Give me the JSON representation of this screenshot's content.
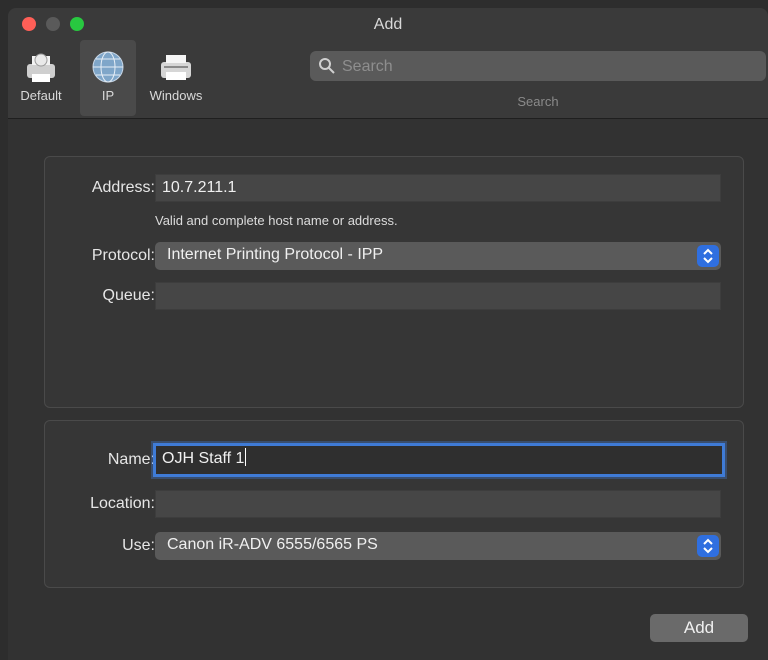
{
  "window": {
    "title": "Add"
  },
  "toolbar": {
    "items": [
      {
        "label": "Default",
        "icon": "default-printer-icon"
      },
      {
        "label": "IP",
        "icon": "globe-icon"
      },
      {
        "label": "Windows",
        "icon": "windows-printer-icon"
      }
    ],
    "search": {
      "placeholder": "Search",
      "label": "Search"
    }
  },
  "ip_panel": {
    "address_label": "Address:",
    "address_value": "10.7.211.1",
    "address_hint": "Valid and complete host name or address.",
    "protocol_label": "Protocol:",
    "protocol_value": "Internet Printing Protocol - IPP",
    "queue_label": "Queue:",
    "queue_value": ""
  },
  "details_panel": {
    "name_label": "Name:",
    "name_value": "OJH Staff 1",
    "location_label": "Location:",
    "location_value": "",
    "use_label": "Use:",
    "use_value": "Canon iR-ADV 6555/6565 PS"
  },
  "actions": {
    "add_label": "Add"
  },
  "colors": {
    "accent": "#2f6fe0",
    "close": "#ff5f57",
    "zoom": "#28c840"
  }
}
